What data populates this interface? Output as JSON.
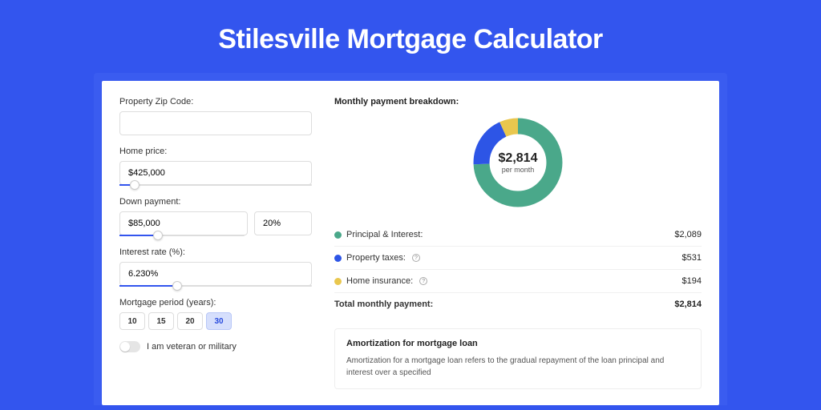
{
  "title": "Stilesville Mortgage Calculator",
  "form": {
    "zip": {
      "label": "Property Zip Code:",
      "value": ""
    },
    "home_price": {
      "label": "Home price:",
      "value": "$425,000",
      "slider_pct": 8
    },
    "down_payment": {
      "label": "Down payment:",
      "amount": "$85,000",
      "pct": "20%",
      "slider_pct": 20
    },
    "interest_rate": {
      "label": "Interest rate (%):",
      "value": "6.230%",
      "slider_pct": 30
    },
    "period": {
      "label": "Mortgage period (years):",
      "options": [
        "10",
        "15",
        "20",
        "30"
      ],
      "selected": "30"
    },
    "veteran": {
      "label": "I am veteran or military",
      "checked": false
    }
  },
  "breakdown": {
    "title": "Monthly payment breakdown:",
    "donut": {
      "amount": "$2,814",
      "sub": "per month"
    },
    "items": [
      {
        "color": "#4aa88a",
        "label": "Principal & Interest:",
        "value": "$2,089",
        "info": false
      },
      {
        "color": "#2d55e6",
        "label": "Property taxes:",
        "value": "$531",
        "info": true
      },
      {
        "color": "#e9c74e",
        "label": "Home insurance:",
        "value": "$194",
        "info": true
      }
    ],
    "total_label": "Total monthly payment:",
    "total_value": "$2,814"
  },
  "amort": {
    "title": "Amortization for mortgage loan",
    "text": "Amortization for a mortgage loan refers to the gradual repayment of the loan principal and interest over a specified"
  },
  "chart_data": {
    "type": "pie",
    "title": "Monthly payment breakdown",
    "series": [
      {
        "name": "Principal & Interest",
        "value": 2089,
        "color": "#4aa88a"
      },
      {
        "name": "Property taxes",
        "value": 531,
        "color": "#2d55e6"
      },
      {
        "name": "Home insurance",
        "value": 194,
        "color": "#e9c74e"
      }
    ],
    "total": 2814,
    "center_label": "$2,814 per month"
  }
}
